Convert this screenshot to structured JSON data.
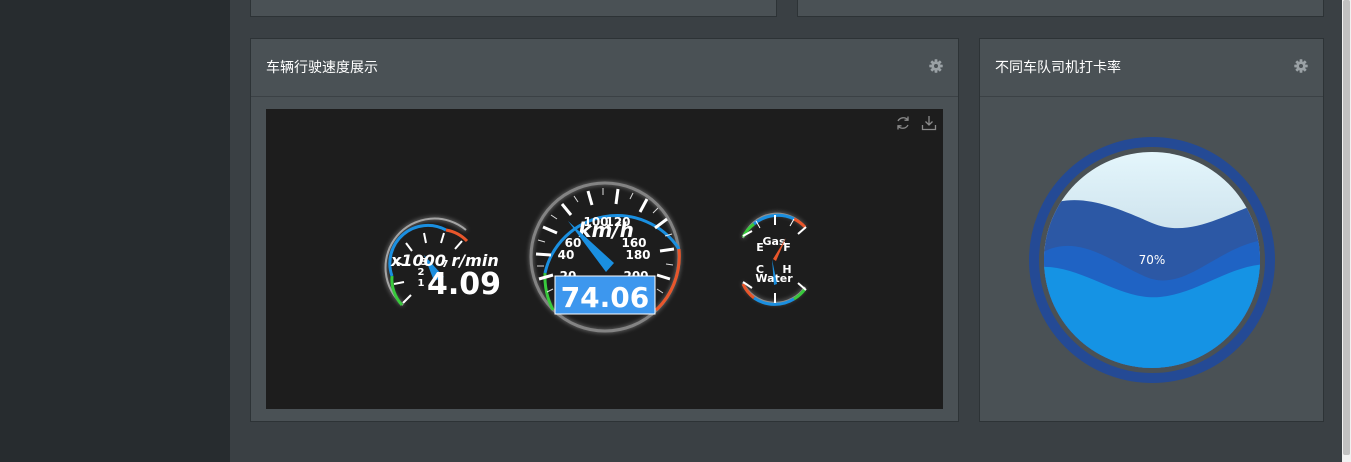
{
  "speed_panel": {
    "title": "车辆行驶速度展示",
    "settings_icon": "gear-icon",
    "toolbar": {
      "refresh_icon": "refresh-icon",
      "download_icon": "download-icon"
    },
    "rpm_gauge": {
      "unit": "x1000 r/min",
      "value": "4.09",
      "ticks": [
        "1",
        "2",
        "3",
        "4",
        "5",
        "6",
        "7"
      ]
    },
    "speed_gauge": {
      "unit": "km/h",
      "value": "74.06",
      "ticks": [
        "20",
        "40",
        "60",
        "100",
        "120",
        "160",
        "180",
        "200"
      ]
    },
    "fuel_gauge": {
      "label": "Gas",
      "empty": "E",
      "full": "F"
    },
    "temp_gauge": {
      "label": "Water",
      "cold": "C",
      "hot": "H"
    }
  },
  "checkin_panel": {
    "title": "不同车队司机打卡率",
    "settings_icon": "gear-icon",
    "liquid": {
      "value": 0.7,
      "label": "70%"
    }
  },
  "colors": {
    "accent_blue": "#1a8fe0",
    "ring": "#244a95",
    "gauge_red": "#e8562b",
    "gauge_green": "#38c93c"
  }
}
